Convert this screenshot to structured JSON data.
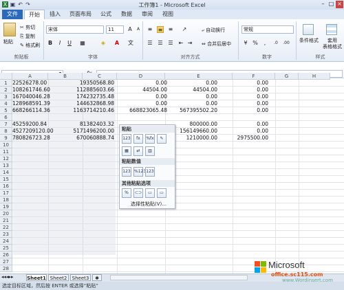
{
  "window": {
    "title": "工作簿1 - Microsoft Excel"
  },
  "tabs": [
    "文件",
    "开始",
    "插入",
    "页面布局",
    "公式",
    "数据",
    "审阅",
    "视图"
  ],
  "ribbon": {
    "paste": "粘贴",
    "cut": "剪切",
    "copy": "复制",
    "format_painter": "格式刷",
    "font_name": "宋体",
    "font_size": "11",
    "bold": "B",
    "italic": "I",
    "underline": "U",
    "wrap": "自动换行",
    "merge": "合并后居中",
    "number_format": "常规",
    "cond_format": "条件格式",
    "table_format": "套用\n表格格式",
    "groups": {
      "clipboard": "剪贴板",
      "font": "字体",
      "align": "对齐方式",
      "number": "数字",
      "style": "样式"
    }
  },
  "formula": {
    "fx": "fx",
    "value": ""
  },
  "columns": [
    "A",
    "B",
    "C",
    "D",
    "E",
    "F",
    "G",
    "H"
  ],
  "rows": [
    {
      "n": "1",
      "a": "22526278.00",
      "b": "19350568.80",
      "c": "0.00",
      "d": "0.00",
      "e": "0.00"
    },
    {
      "n": "2",
      "a": "108261746.60",
      "b": "112885603.66",
      "c": "44504.00",
      "d": "44504.00",
      "e": "0.00"
    },
    {
      "n": "3",
      "a": "167040046.28",
      "b": "174232735.48",
      "c": "0.00",
      "d": "0.00",
      "e": "0.00"
    },
    {
      "n": "4",
      "a": "128968591.39",
      "b": "144632868.98",
      "c": "0.00",
      "d": "0.00",
      "e": "0.00"
    },
    {
      "n": "5",
      "a": "668266114.36",
      "b": "1163714210.46",
      "c": "668823065.48",
      "d": "567395502.20",
      "e": "0.00"
    },
    {
      "n": "6",
      "a": "",
      "b": "",
      "c": "",
      "d": "",
      "e": ""
    },
    {
      "n": "7",
      "a": "45259200.84",
      "b": "81382403.32",
      "c": "",
      "d": "800000.00",
      "e": "0.00"
    },
    {
      "n": "8",
      "a": "4527209120.00",
      "b": "5171496200.00",
      "c": "",
      "d": "156149660.00",
      "e": "0.00"
    },
    {
      "n": "9",
      "a": "780826723.28",
      "b": "670060888.74",
      "c": "",
      "d": "1210000.00",
      "e": "2975500.00"
    },
    {
      "n": "10"
    },
    {
      "n": "11"
    },
    {
      "n": "12"
    },
    {
      "n": "13"
    },
    {
      "n": "14"
    },
    {
      "n": "15"
    },
    {
      "n": "16"
    },
    {
      "n": "17"
    },
    {
      "n": "18"
    },
    {
      "n": "19"
    },
    {
      "n": "20"
    },
    {
      "n": "21"
    },
    {
      "n": "22"
    },
    {
      "n": "23"
    },
    {
      "n": "24"
    },
    {
      "n": "25"
    },
    {
      "n": "26"
    },
    {
      "n": "27"
    },
    {
      "n": "28"
    }
  ],
  "context_menu": {
    "paste_header": "粘贴",
    "paste_values_header": "粘贴数值",
    "other_header": "其他粘贴选项",
    "paste_special": "选择性粘贴(V)...",
    "icons_paste": [
      "123",
      "fx",
      "%fx",
      "✎",
      "▦",
      "⇄",
      "▥"
    ],
    "icons_values": [
      "123",
      "%123",
      "123"
    ],
    "icons_other": [
      "%",
      "⊂⊃",
      "▭",
      "▭"
    ]
  },
  "sheets": [
    "Sheet1",
    "Sheet2",
    "Sheet3"
  ],
  "status": "选定目标区域，然后按 ENTER 或选择“粘贴”",
  "watermark": {
    "brand": "Microsoft",
    "site": "office.sc115.com",
    "site2": "www.Wordinsert.com"
  }
}
